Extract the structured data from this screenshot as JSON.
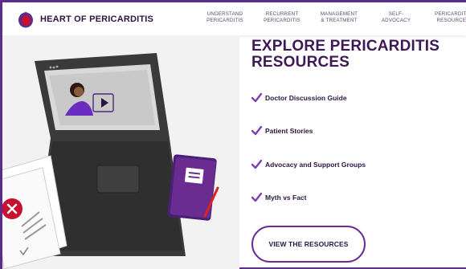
{
  "header": {
    "logo_text": "HEART OF PERICARDITIS",
    "nav": [
      "UNDERSTAND\nPERICARDITIS",
      "RECURRENT\nPERICARDITIS",
      "MANAGEMENT\n& TREATMENT",
      "SELF-\nADVOCACY",
      "PERICARDITIS\nRESOURCES"
    ]
  },
  "hero": {
    "title": "EXPLORE PERICARDITIS RESOURCES",
    "resources": [
      "Doctor Discussion Guide",
      "Patient Stories",
      "Advocacy and Support Groups",
      "Myth vs Fact"
    ],
    "cta_label": "VIEW THE RESOURCES"
  },
  "colors": {
    "brand_purple": "#5b2d8e",
    "check_purple": "#7b3fb0",
    "title": "#3d1a57",
    "logo_red": "#c8102e"
  }
}
